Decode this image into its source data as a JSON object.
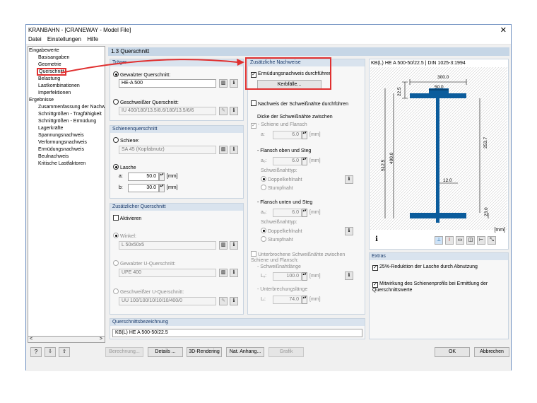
{
  "window": {
    "title": "KRANBAHN - [CRANEWAY - Model File]"
  },
  "menu": [
    "Datei",
    "Einstellungen",
    "Hilfe"
  ],
  "tree": {
    "items": [
      "Eingabewerte",
      "Basisangaben",
      "Geometrie",
      "Querschnitt",
      "Belastung",
      "Lastkombinationen",
      "Imperfektionen",
      "Ergebnisse",
      "Zusammenfassung der Nachwe",
      "Schnittgrößen - Tragfähigkeit",
      "Schnittgrößen - Ermüdung",
      "Lagerkräfte",
      "Spannungsnachweis",
      "Verformungsnachweis",
      "Ermüdungsnachweis",
      "Beulnachweis",
      "Kritische Lastfaktoren"
    ],
    "selected": "Querschnitt",
    "scroll_left": "<",
    "scroll_right": ">"
  },
  "header": {
    "title": "1.3 Querschnitt"
  },
  "traeger": {
    "title": "Träger",
    "gewalzt_label": "Gewalzter Querschnitt:",
    "gewalzt_value": "HE-A 500",
    "geschweisst_label": "Geschweißter Querschnitt:",
    "geschweisst_value": "IU 400/180/13.5/8.6/180/13.5/6/6"
  },
  "schiene": {
    "title": "Schienenquerschnitt",
    "schiene_label": "Schiene:",
    "schiene_value": "SA 45 (Kopfabnutz)",
    "lasche_label": "Lasche",
    "a_label": "a:",
    "a_value": "50.0",
    "b_label": "b:",
    "b_value": "30.0",
    "unit": "[mm]"
  },
  "zusatz_qs": {
    "title": "Zusätzlicher Querschnitt",
    "aktivieren": "Aktivieren",
    "winkel_label": "Winkel:",
    "winkel_value": "L 50x50x5",
    "u_gew_label": "Gewalzter U-Querschnitt:",
    "u_gew_value": "UPE 400",
    "u_ges_label": "Geschweißter U-Querschnitt:",
    "u_ges_value": "UU 100/100/10/10/10/400/0"
  },
  "bezeichnung": {
    "title": "Querschnittsbezeichnung",
    "value": "KB(L) HE A 500-50/22.5"
  },
  "nachweise": {
    "title": "Zusätzliche Nachweise",
    "ermuedung": "Ermüdungsnachweis durchführen",
    "kerbfaelle": "Kerbfälle...",
    "schweiss": "Nachweis der Schweißnähte durchführen",
    "dicke": "Dicke der Schweißnähte zwischen",
    "schiene_flansch": "- Schiene und Flansch",
    "a_sym": "a:",
    "a_val": "6.0",
    "flansch_oben": "- Flansch oben und Steg",
    "ao_sym": "aₒ:",
    "ao_val": "6.0",
    "nahttyp1": "Schweißnahttyp:",
    "doppel1": "Doppelkehlnaht",
    "stumpf1": "Stumpfnaht",
    "flansch_unten": "- Flansch unten und Steg",
    "au_sym": "aᵤ:",
    "au_val": "6.0",
    "nahttyp2": "Schweißnahttyp:",
    "doppel2": "Doppelkehlnaht",
    "stumpf2": "Stumpfnaht",
    "unterbrochen": "Unterbrochene Schweißnähte zwischen Schiene und Flansch:",
    "nahtlaenge": "- Schweißnahtlänge",
    "lw_sym": "Lᵥ:",
    "lw_val": "100.0",
    "unterbrechung": "- Unterbrechungslänge",
    "li_sym": "Lᵢ:",
    "li_val": "74.0",
    "unit": "[mm]"
  },
  "drawing": {
    "caption": "KB(L) HE A 500-50/22.5 | DIN 1025-3:1994",
    "dims": [
      "300.0",
      "50.0",
      "22.5",
      "253.7",
      "512.5",
      "490.0",
      "12.0",
      "23.0"
    ],
    "unit": "[mm]"
  },
  "extras": {
    "title": "Extras",
    "opt1": "25%-Reduktion der Lasche durch Abnutzung",
    "opt2": "Mitwirkung des Schienenprofils bei Ermittlung der Querschnittswerte"
  },
  "footer": {
    "berechnung": "Berechnung...",
    "details": "Details ...",
    "rendering": "3D-Rendering",
    "anhang": "Nat. Anhang...",
    "grafik": "Grafik",
    "ok": "OK",
    "abbrechen": "Abbrechen"
  },
  "colors": {
    "highlight": "#e03030",
    "header": "#c6d6e6",
    "panel_title": "#d9e3ee"
  }
}
